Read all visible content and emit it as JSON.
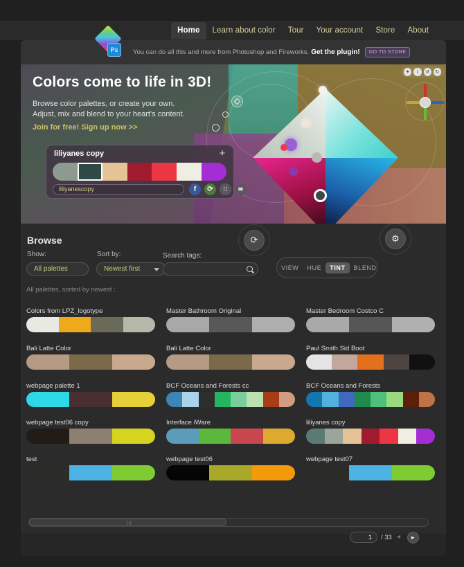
{
  "nav": {
    "items": [
      {
        "label": "Home",
        "active": true
      },
      {
        "label": "Learn about color",
        "active": false
      },
      {
        "label": "Tour",
        "active": false
      },
      {
        "label": "Your account",
        "active": false
      },
      {
        "label": "Store",
        "active": false
      },
      {
        "label": "About",
        "active": false
      }
    ]
  },
  "plugin_bar": {
    "text": "You can do all this and more from Photoshop and Fireworks.",
    "strong": "Get the plugin!",
    "button": "GO TO STORE",
    "logo_badge": "Ps"
  },
  "hero": {
    "title": "Colors come to life in 3D!",
    "sub1": "Browse color palettes, or create your own.",
    "sub2": "Adjust, mix and blend to your heart's content.",
    "link": "Join for free! Sign up now >>"
  },
  "palette_card": {
    "title": "liliyanes copy",
    "add_label": "+",
    "name_value": "liliyanescopy",
    "swatches": [
      "#8d9a90",
      "#2f4a46",
      "#e6c396",
      "#a01b2e",
      "#ed3644",
      "#efeee3",
      "#a42ed4"
    ],
    "selected_index": 1,
    "share": [
      {
        "name": "facebook-share-button",
        "glyph": "f"
      },
      {
        "name": "rss-share-button",
        "glyph": "⟳"
      },
      {
        "name": "grid-share-button",
        "glyph": "∷"
      },
      {
        "name": "more-share-button",
        "glyph": "✉"
      }
    ]
  },
  "viewer": {
    "top_buttons": [
      "☀",
      "i",
      "↺",
      "↻"
    ],
    "gizmo_axes": [
      "x",
      "y",
      "z"
    ]
  },
  "browse": {
    "heading": "Browse",
    "show_label": "Show:",
    "show_value": "All palettes",
    "sort_label": "Sort by:",
    "sort_value": "Newest first",
    "search_label": "Search tags:",
    "search_value": "",
    "search_placeholder": "",
    "refresh_icon": "⟳",
    "settings_icon": "⚙",
    "modes": [
      {
        "label": "VIEW",
        "active": false
      },
      {
        "label": "HUE",
        "active": false
      },
      {
        "label": "TINT",
        "active": true
      },
      {
        "label": "BLEND",
        "active": false
      }
    ],
    "sorted_by": "All palettes, sorted by newest :"
  },
  "palettes": [
    {
      "name": "Colors from LPZ_logotype",
      "colors": [
        "#e9e9e4",
        "#f0a91b",
        "#6a6a59",
        "#b6b8aa"
      ]
    },
    {
      "name": "Master Bathroom Original",
      "colors": [
        "#a8a8a8",
        "#585858",
        "#aeaeae"
      ]
    },
    {
      "name": "Master Bedroom Costco C",
      "colors": [
        "#a9a9a9",
        "#565656",
        "#b0b0b0"
      ]
    },
    {
      "name": "Bali Latte Color",
      "colors": [
        "#b79a83",
        "#7a6a4a",
        "#c9a98e"
      ]
    },
    {
      "name": "Bali Latte Color",
      "colors": [
        "#b79a83",
        "#7a6a4a",
        "#c9a98e"
      ]
    },
    {
      "name": "Paul Smith Sid Boot",
      "colors": [
        "#e4e4e4",
        "#c3a79c",
        "#e2701c",
        "#4e4440",
        "#111111"
      ]
    },
    {
      "name": "webpage palette 1",
      "colors": [
        "#2ed8e8",
        "#4a2f30",
        "#e6d038"
      ]
    },
    {
      "name": "BCF Oceans and Forests cc",
      "colors": [
        "#3a86b4",
        "#a9d3ea",
        "#2e2e2e",
        "#25b562",
        "#79cf9a",
        "#bde0b0",
        "#a83c16",
        "#d39b80"
      ]
    },
    {
      "name": "BCF Oceans and Forests",
      "colors": [
        "#1277ad",
        "#52b0dd",
        "#4069bd",
        "#1f8a4f",
        "#4cc07c",
        "#9ad97e",
        "#5e1e0c",
        "#c07247"
      ]
    },
    {
      "name": "webpage test06 copy",
      "colors": [
        "#211c18",
        "#8c8070",
        "#d6d321"
      ]
    },
    {
      "name": "Interface iWare",
      "colors": [
        "#5a9cba",
        "#5ab93c",
        "#c8464e",
        "#dda92e"
      ]
    },
    {
      "name": "liliyanes copy",
      "colors": [
        "#5c7a74",
        "#9aa698",
        "#e6c396",
        "#a01b2e",
        "#ed3644",
        "#efeee3",
        "#a42ed4"
      ]
    },
    {
      "name": "test",
      "colors": [
        "#2b2b28",
        "#4cb2e2",
        "#7fcb32"
      ]
    },
    {
      "name": "webpage test06",
      "colors": [
        "#050505",
        "#a8a829",
        "#f49a09"
      ]
    },
    {
      "name": "webpage test07",
      "colors": [
        "#2b2b28",
        "#4cb2e2",
        "#7fcb32"
      ]
    }
  ],
  "footer": {
    "page_value": "1",
    "page_total": "/ 33",
    "prev_icon": "◄",
    "next_icon": "►",
    "scroll_grip": "|||"
  }
}
